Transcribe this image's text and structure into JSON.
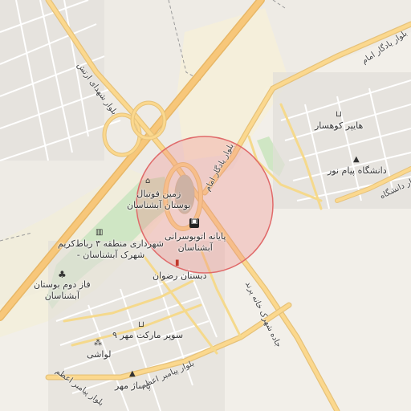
{
  "map": {
    "highlight_color": "#f08080",
    "pois": {
      "football_field": {
        "icon": "stadium-icon",
        "line1": "زمین فوتبال",
        "line2": "بوستان آبشناسان"
      },
      "bus_terminal": {
        "icon": "bus-icon",
        "line1": "پایانه اتوبوسرانی",
        "line2": "آبشناسان"
      },
      "municipality": {
        "icon": "government-icon",
        "line1": "شهرداری منطقه ۳ رباط‌کریم",
        "line2": "- شهرک آبشناسان"
      },
      "park_phase2": {
        "icon": "tree-icon",
        "line1": "فاز دوم بوستان",
        "line2": "آبشناسان"
      },
      "school": {
        "icon": "school-icon",
        "line1": "دبستان رضوان"
      },
      "supermarket": {
        "icon": "cart-icon",
        "line1": "سوپر مارکت مهر ۹"
      },
      "lavashi": {
        "icon": "cluster-icon",
        "line1": "لواشی"
      },
      "pasaj": {
        "icon": "mall-icon",
        "line1": "پاساژ مهر"
      },
      "hyper": {
        "icon": "cart-icon",
        "line1": "هایپر کوهسار"
      },
      "university": {
        "icon": "graduation-cap-icon",
        "line1": "دانشگاه پیام نور"
      }
    },
    "roads": {
      "boulevard_emam": "بلوار یادگار امام",
      "emam_top": "بلوار یادگار امام",
      "shahid_arteh": "بلوار شهدای ارتش",
      "shahrak_road": "جاده شهرک خانه پرند",
      "payambar_a": "بلوار پیامبر اعظم",
      "payambar_b": "بلوار پیامبر اعظم",
      "daneshgah": "بلوار دانشگاه"
    }
  }
}
